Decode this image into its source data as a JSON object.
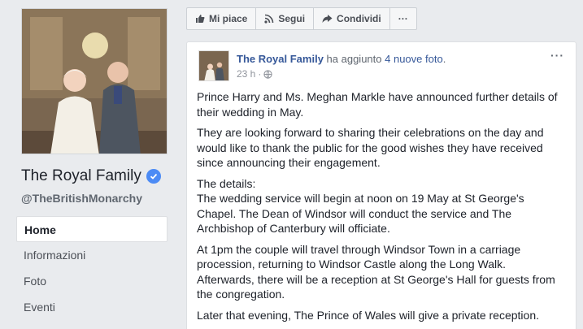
{
  "page": {
    "name": "The Royal Family",
    "handle": "@TheBritishMonarchy"
  },
  "nav": [
    {
      "label": "Home"
    },
    {
      "label": "Informazioni"
    },
    {
      "label": "Foto"
    },
    {
      "label": "Eventi"
    }
  ],
  "actions": {
    "like": "Mi piace",
    "follow": "Segui",
    "share": "Condividi",
    "more": "···"
  },
  "post": {
    "author": "The Royal Family",
    "action": "ha aggiunto",
    "action_link": "4 nuove foto",
    "action_end": ".",
    "time": "23 h",
    "meta_sep": "·",
    "privacy_icon": "globe-icon",
    "more": "···",
    "paragraphs": [
      "Prince Harry and Ms. Meghan Markle have announced further details of their wedding in May.",
      "They are looking forward to sharing their celebrations on the day and would like to thank the public for the good wishes they have received since announcing their engagement.",
      "The details:\nThe wedding service will begin at noon on 19 May at St George's Chapel. The Dean of Windsor will conduct the service and The Archbishop of Canterbury will officiate.",
      "At 1pm the couple will travel through Windsor Town in a carriage procession, returning to Windsor Castle along the Long Walk. Afterwards, there will be a reception at St George's Hall for guests from the congregation.",
      "Later that evening, The Prince of Wales will give a private reception."
    ]
  },
  "colors": {
    "link": "#365899",
    "verified": "#4c8bf5",
    "background": "#e9ebee"
  }
}
